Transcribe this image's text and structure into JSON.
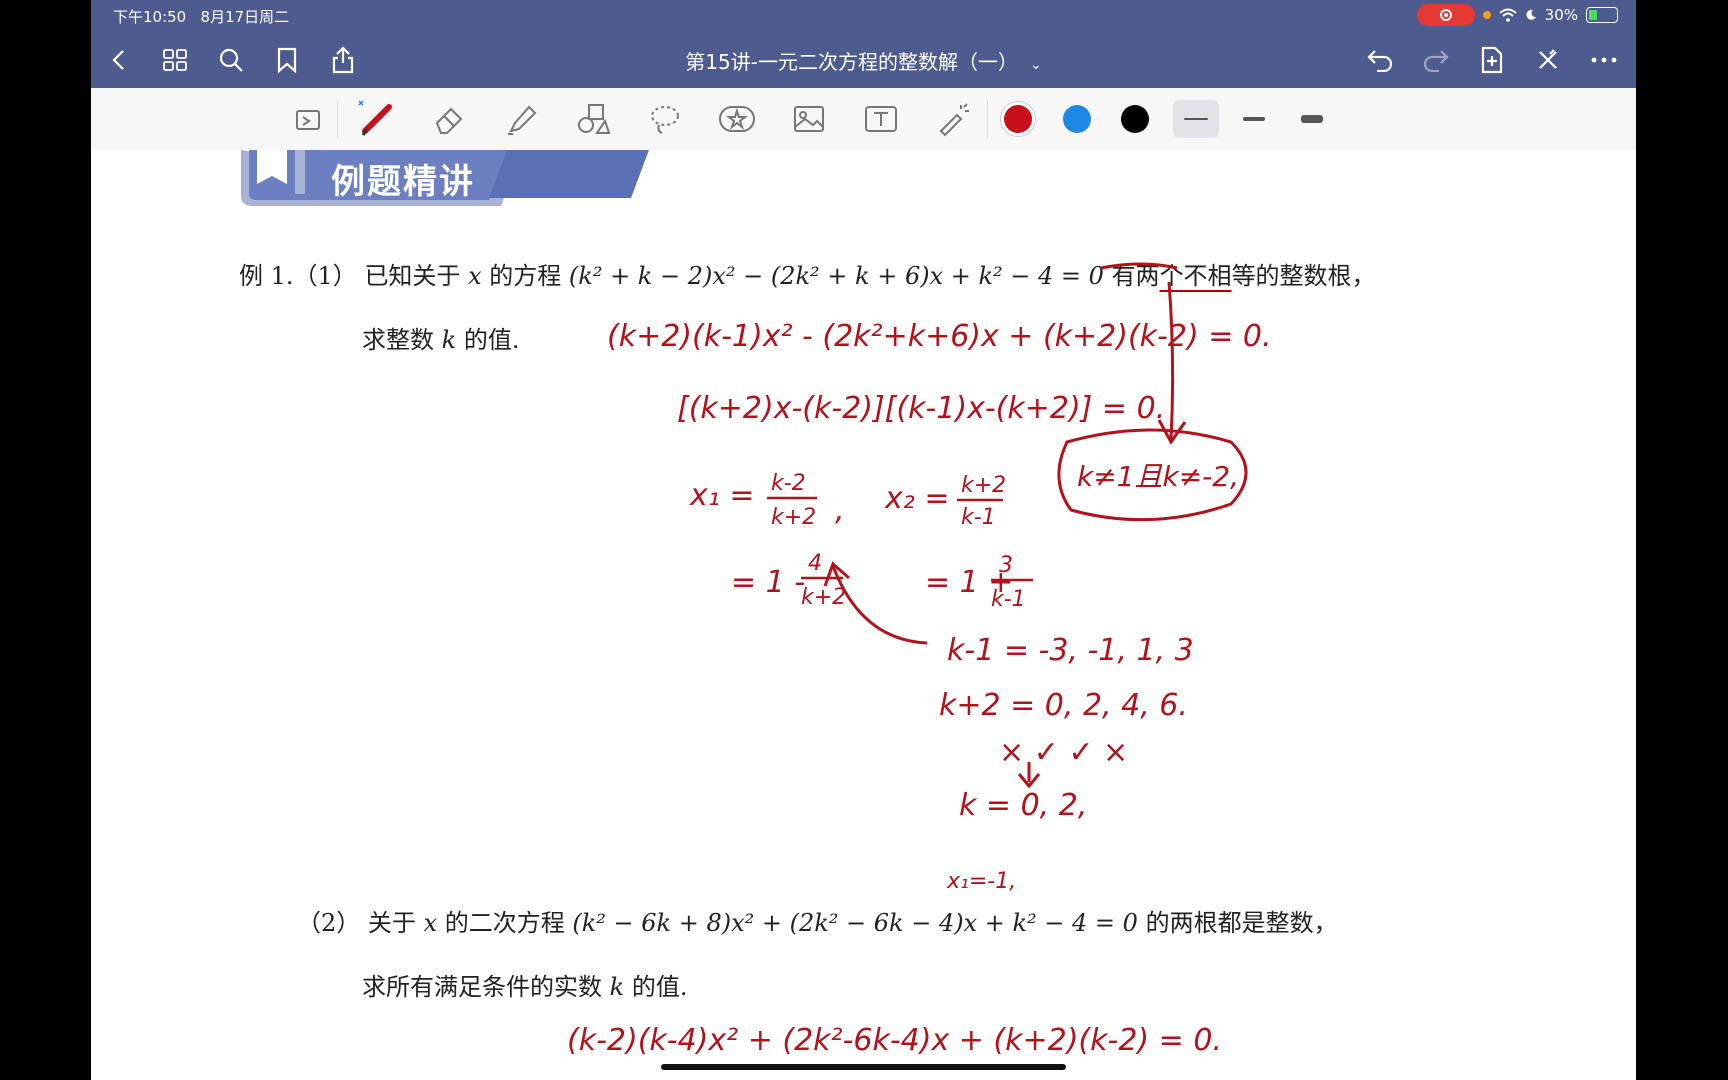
{
  "status_bar": {
    "time": "下午10:50",
    "date": "8月17日周二",
    "battery": "30%",
    "battery_level": 0.3
  },
  "nav": {
    "title": "第15讲-一元二次方程的整数解（一）",
    "title_chevron": "⌄"
  },
  "toolbar": {
    "colors": [
      "#c8101b",
      "#1e88e5",
      "#000000"
    ],
    "selected_color": "#c8101b"
  },
  "page": {
    "banner": "例题精讲",
    "q1_label": "例 1.（1）",
    "q1_line1_a": "已知关于",
    "q1_var_x": "x",
    "q1_line1_b": "的方程",
    "q1_equation": "(k² + k − 2)x² − (2k² + k + 6)x + k² − 4 = 0",
    "q1_line1_c": "有两",
    "q1_line1_d": "个不相",
    "q1_line1_e": "等的整数根，",
    "q1_line2_a": "求整数",
    "q1_var_k": "k",
    "q1_line2_b": "的值.",
    "q2_label": "（2）",
    "q2_line1_a": "关于",
    "q2_var_x": "x",
    "q2_line1_b": "的二次方程",
    "q2_equation": "(k² − 6k + 8)x² + (2k² − 6k − 4)x + k² − 4 = 0",
    "q2_line1_c": "的两根都是整数，",
    "q2_line2_a": "求所有满足条件的实数",
    "q2_var_k": "k",
    "q2_line2_b": "的值."
  },
  "handwriting": {
    "line1": "(k+2)(k-1)x² - (2k²+k+6)x + (k+2)(k-2) = 0.",
    "line2": "[(k+2)x-(k-2)][(k-1)x-(k+2)] = 0.",
    "x1_lhs": "x₁ =",
    "x1_num": "k-2",
    "x1_den": "k+2",
    "comma": ",",
    "x2_lhs": "x₂ =",
    "x2_num": "k+2",
    "x2_den": "k-1",
    "boxed": "k≠1且k≠-2,",
    "x1_rw_a": "= 1 -",
    "x1_rw_num": "4",
    "x1_rw_den": "k+2",
    "x2_rw_a": "= 1 +",
    "x2_rw_num": "3",
    "x2_rw_den": "k-1",
    "km1": "k-1 = -3, -1, 1, 3",
    "kp2": "k+2 = 0, 2, 4, 6.",
    "marks": "×  ✓  ✓  ×",
    "k_values": "k =  0, 2,",
    "x1_value": "x₁=-1,",
    "q2_line": "(k-2)(k-4)x² + (2k²-6k-4)x + (k+2)(k-2) = 0."
  }
}
